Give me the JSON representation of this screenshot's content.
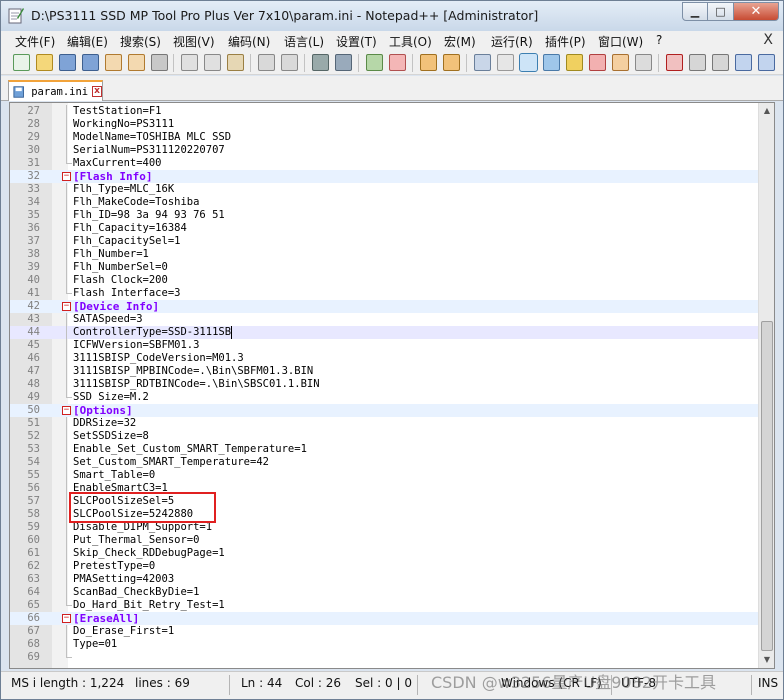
{
  "window": {
    "title": "D:\\PS3111 SSD MP Tool Pro Plus Ver 7x10\\param.ini - Notepad++ [Administrator]"
  },
  "menu": [
    "文件(F)",
    "编辑(E)",
    "搜索(S)",
    "视图(V)",
    "编码(N)",
    "语言(L)",
    "设置(T)",
    "工具(O)",
    "宏(M)",
    "运行(R)",
    "插件(P)",
    "窗口(W)",
    "?"
  ],
  "menu_close": "X",
  "tab": {
    "label": "param.ini"
  },
  "lines": [
    {
      "n": "27",
      "text": "TestStation=F1"
    },
    {
      "n": "28",
      "text": "WorkingNo=PS3111"
    },
    {
      "n": "29",
      "text": "ModelName=TOSHIBA MLC SSD"
    },
    {
      "n": "30",
      "text": "SerialNum=PS311120220707"
    },
    {
      "n": "31",
      "text": "MaxCurrent=400"
    },
    {
      "n": "32",
      "text": "[Flash Info]",
      "section": true
    },
    {
      "n": "33",
      "text": "Flh_Type=MLC_16K"
    },
    {
      "n": "34",
      "text": "Flh_MakeCode=Toshiba"
    },
    {
      "n": "35",
      "text": "Flh_ID=98 3a 94 93 76 51"
    },
    {
      "n": "36",
      "text": "Flh_Capacity=16384"
    },
    {
      "n": "37",
      "text": "Flh_CapacitySel=1"
    },
    {
      "n": "38",
      "text": "Flh_Number=1"
    },
    {
      "n": "39",
      "text": "Flh_NumberSel=0"
    },
    {
      "n": "40",
      "text": "Flash Clock=200"
    },
    {
      "n": "41",
      "text": "Flash Interface=3"
    },
    {
      "n": "42",
      "text": "[Device Info]",
      "section": true
    },
    {
      "n": "43",
      "text": "SATASpeed=3"
    },
    {
      "n": "44",
      "text": "ControllerType=SSD-3111SB",
      "current": true
    },
    {
      "n": "45",
      "text": "ICFWVersion=SBFM01.3"
    },
    {
      "n": "46",
      "text": "3111SBISP_CodeVersion=M01.3"
    },
    {
      "n": "47",
      "text": "3111SBISP_MPBINCode=.\\Bin\\SBFM01.3.BIN"
    },
    {
      "n": "48",
      "text": "3111SBISP_RDTBINCode=.\\Bin\\SBSC01.1.BIN"
    },
    {
      "n": "49",
      "text": "SSD Size=M.2"
    },
    {
      "n": "50",
      "text": "[Options]",
      "section": true
    },
    {
      "n": "51",
      "text": "DDRSize=32"
    },
    {
      "n": "52",
      "text": "SetSSDSize=8"
    },
    {
      "n": "53",
      "text": "Enable_Set_Custom_SMART_Temperature=1"
    },
    {
      "n": "54",
      "text": "Set_Custom_SMART_Temperature=42"
    },
    {
      "n": "55",
      "text": "Smart_Table=0"
    },
    {
      "n": "56",
      "text": "EnableSmartC3=1"
    },
    {
      "n": "57",
      "text": "SLCPoolSizeSel=5"
    },
    {
      "n": "58",
      "text": "SLCPoolSize=5242880"
    },
    {
      "n": "59",
      "text": "Disable_DIPM_Support=1"
    },
    {
      "n": "60",
      "text": "Put_Thermal_Sensor=0"
    },
    {
      "n": "61",
      "text": "Skip_Check_RDDebugPage=1"
    },
    {
      "n": "62",
      "text": "PretestType=0"
    },
    {
      "n": "63",
      "text": "PMASetting=42003"
    },
    {
      "n": "64",
      "text": "ScanBad_CheckByDie=1"
    },
    {
      "n": "65",
      "text": "Do_Hard_Bit_Retry_Test=1"
    },
    {
      "n": "66",
      "text": "[EraseAll]",
      "section": true
    },
    {
      "n": "67",
      "text": "Do_Erase_First=1"
    },
    {
      "n": "68",
      "text": "Type=01"
    },
    {
      "n": "69",
      "text": ""
    }
  ],
  "status": {
    "length": "MS i length : 1,224",
    "lines": "lines : 69",
    "ln": "Ln : 44",
    "col": "Col : 26",
    "sel": "Sel : 0 | 0",
    "eol": "Windows (CR LF)",
    "encoding": "UTF-8",
    "mode": "INS"
  },
  "watermark": "CSDN @w3256量产U盘9082开卡工具"
}
